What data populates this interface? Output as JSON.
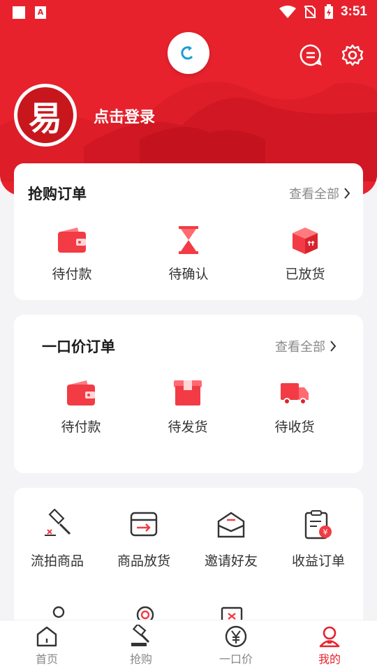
{
  "statusbar": {
    "time": "3:51"
  },
  "header": {
    "login_text": "点击登录",
    "avatar_char": "易"
  },
  "grab_orders": {
    "title": "抢购订单",
    "view_all": "查看全部",
    "items": [
      {
        "label": "待付款",
        "icon": "wallet-icon"
      },
      {
        "label": "待确认",
        "icon": "hourglass-icon"
      },
      {
        "label": "已放货",
        "icon": "box-icon"
      }
    ]
  },
  "fixed_price_orders": {
    "title": "一口价订单",
    "view_all": "查看全部",
    "items": [
      {
        "label": "待付款",
        "icon": "wallet-icon"
      },
      {
        "label": "待发货",
        "icon": "package-icon"
      },
      {
        "label": "待收货",
        "icon": "truck-icon"
      }
    ]
  },
  "tools": {
    "items": [
      {
        "label": "流拍商品",
        "icon": "gavel-icon"
      },
      {
        "label": "商品放货",
        "icon": "inbox-arrow-icon"
      },
      {
        "label": "邀请好友",
        "icon": "envelope-icon"
      },
      {
        "label": "收益订单",
        "icon": "clipboard-money-icon"
      }
    ]
  },
  "bottom_nav": {
    "items": [
      {
        "label": "首页",
        "icon": "home-icon",
        "active": false
      },
      {
        "label": "抢购",
        "icon": "auction-icon",
        "active": false
      },
      {
        "label": "一口价",
        "icon": "yen-icon",
        "active": false
      },
      {
        "label": "我的",
        "icon": "user-icon",
        "active": true
      }
    ]
  },
  "colors": {
    "primary": "#e7222d",
    "accent_light": "#ff5a5f",
    "refresh": "#1a9bd7"
  }
}
